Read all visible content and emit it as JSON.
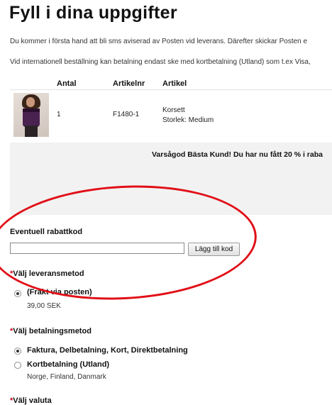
{
  "page": {
    "title": "Fyll i dina uppgifter",
    "intro_line1": "Du kommer i första hand att bli sms aviserad av Posten vid leverans. Därefter skickar Posten e",
    "intro_line2": "Vid internationell beställning kan betalning endast ske med kortbetalning (Utland) som t.ex Visa,"
  },
  "cart": {
    "headers": [
      "Antal",
      "Artikelnr",
      "Artikel"
    ],
    "rows": [
      {
        "qty": "1",
        "sku": "F1480-1",
        "name": "Korsett",
        "variant": "Storlek: Medium",
        "image": "corset-product-photo"
      }
    ]
  },
  "promo": {
    "message": "Varsågod Bästa Kund! Du har nu fått 20 % i raba"
  },
  "coupon": {
    "label": "Eventuell rabattkod",
    "value": "",
    "button_label": "Lägg till kod"
  },
  "shipping": {
    "required_mark": "*",
    "label": "Välj leveransmetod",
    "options": [
      {
        "label": "(Frakt via posten)",
        "price": "39,00 SEK",
        "selected": true
      }
    ]
  },
  "payment": {
    "required_mark": "*",
    "label": "Välj betalningsmetod",
    "options": [
      {
        "label": "Faktura, Delbetalning, Kort, Direktbetalning",
        "note": "",
        "selected": true
      },
      {
        "label": "Kortbetalning (Utland)",
        "note": "Norge, Finland, Danmark",
        "selected": false
      }
    ]
  },
  "currency": {
    "required_mark": "*",
    "label": "Välj valuta"
  },
  "colors": {
    "annotation": "#e10f17",
    "required": "#d0021b",
    "promo_bg": "#f2f2f2"
  }
}
